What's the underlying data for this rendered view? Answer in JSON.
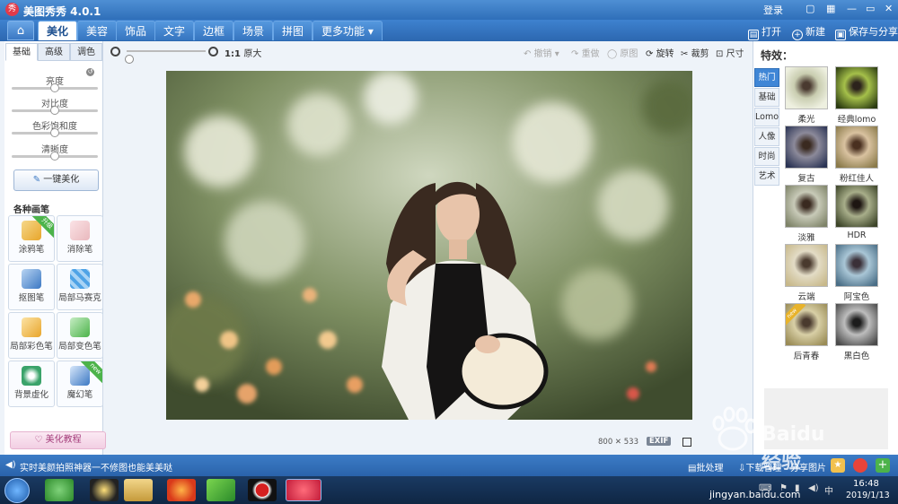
{
  "app": {
    "title": "美图秀秀 4.0.1",
    "logo_glyph": "秀"
  },
  "window": {
    "login": "登录",
    "icons": [
      "speech-bubble-icon",
      "grid-icon",
      "minimize-icon",
      "maximize-icon",
      "close-icon"
    ]
  },
  "menubar": {
    "tabs": [
      "美化",
      "美容",
      "饰品",
      "文字",
      "边框",
      "场景",
      "拼图",
      "更多功能 ▾"
    ],
    "active_tab": "美化",
    "open_label": "打开",
    "new_label": "新建",
    "save_label": "保存与分享"
  },
  "left": {
    "subtabs": [
      "基础",
      "高级",
      "调色"
    ],
    "sliders": [
      {
        "label": "亮度",
        "value": 0.5
      },
      {
        "label": "对比度",
        "value": 0.5
      },
      {
        "label": "色彩饱和度",
        "value": 0.5
      },
      {
        "label": "清晰度",
        "value": 0.5
      }
    ],
    "onekey_label": "一键美化",
    "brushes_title": "各种画笔",
    "brushes": [
      {
        "label": "涂鸦笔",
        "badge": "升级",
        "icon": "pencil-icon",
        "color": "#e8a52b"
      },
      {
        "label": "消除笔",
        "badge": "",
        "icon": "eraser-icon",
        "color": "#e9b8bd"
      },
      {
        "label": "抠图笔",
        "badge": "",
        "icon": "pen-nib-icon",
        "color": "#3b78c3"
      },
      {
        "label": "局部马赛克",
        "badge": "",
        "icon": "mosaic-icon",
        "color": "#4fa3e6"
      },
      {
        "label": "局部彩色笔",
        "badge": "",
        "icon": "paint-brush-icon",
        "color": "#e8a52b"
      },
      {
        "label": "局部变色笔",
        "badge": "",
        "icon": "color-bucket-icon",
        "color": "#4cb34a"
      },
      {
        "label": "背景虚化",
        "badge": "",
        "icon": "camera-blur-icon",
        "color": "#3aa36a"
      },
      {
        "label": "魔幻笔",
        "badge": "new",
        "icon": "magic-wand-icon",
        "color": "#3b78c3"
      }
    ],
    "tutorial_label": "美化教程"
  },
  "canvas": {
    "zoom_ratio": "1:1",
    "zoom_label": "原大",
    "undo": "撤销",
    "redo": "重做",
    "original": "原图",
    "rotate": "旋转",
    "crop": "裁剪",
    "size": "尺寸",
    "image_width": "800",
    "image_height": "533",
    "exif": "EXIF"
  },
  "effects": {
    "title": "特效：",
    "categories": [
      "热门",
      "基础",
      "Lomo",
      "人像",
      "时尚",
      "艺术"
    ],
    "active_category": "热门",
    "items": [
      {
        "label": "柔光",
        "badge": ""
      },
      {
        "label": "经典lomo",
        "badge": ""
      },
      {
        "label": "复古",
        "badge": ""
      },
      {
        "label": "粉红佳人",
        "badge": ""
      },
      {
        "label": "淡雅",
        "badge": ""
      },
      {
        "label": "HDR",
        "badge": ""
      },
      {
        "label": "云端",
        "badge": ""
      },
      {
        "label": "阿宝色",
        "badge": ""
      },
      {
        "label": "后青春",
        "badge": "new"
      },
      {
        "label": "黑白色",
        "badge": ""
      }
    ]
  },
  "statusbar": {
    "tip": "实时美颜拍照神器一不修图也能美美哒",
    "batch": "批处理",
    "download": "下载管理",
    "share": "分享图片"
  },
  "taskbar": {
    "time": "16:48",
    "date": "2019/1/13"
  },
  "watermark": {
    "text": "Baidu 经验",
    "url": "jingyan.baidu.com"
  }
}
